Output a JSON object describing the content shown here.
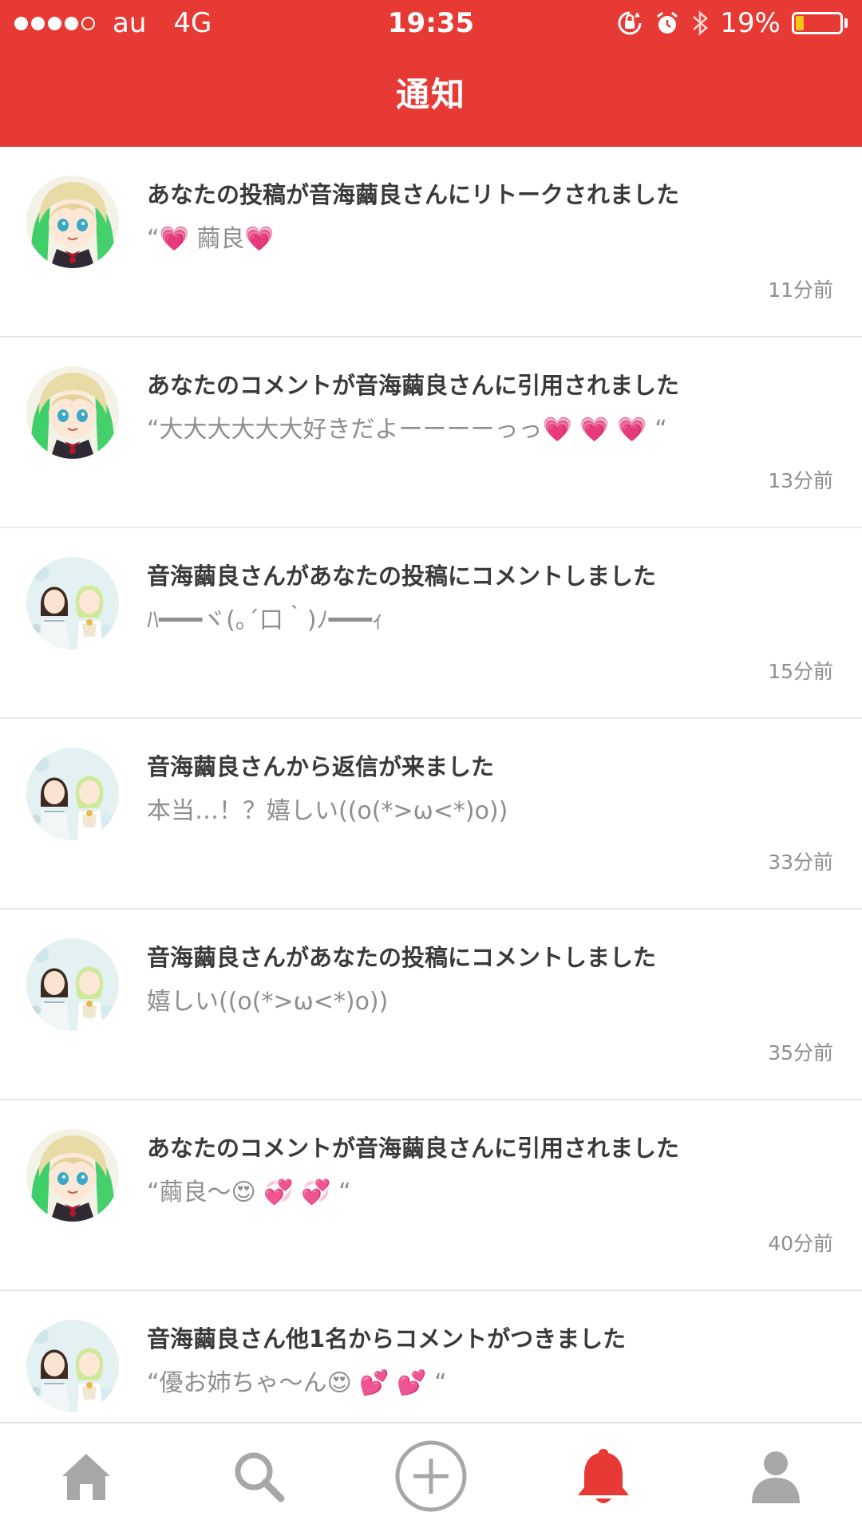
{
  "status_bar": {
    "carrier": "au",
    "network": "4G",
    "time": "19:35",
    "battery": "19%",
    "battery_level": 0.19,
    "signal_bars": 4
  },
  "header": {
    "title": "通知"
  },
  "notifications": [
    {
      "title": "あなたの投稿が音海繭良さんにリトークされました",
      "body": "“💗 繭良💗",
      "time": "11分前",
      "avatar": "green-hair"
    },
    {
      "title": "あなたのコメントが音海繭良さんに引用されました",
      "body": "“大大大大大大好きだよーーーーっっ💗 💗 💗 “",
      "time": "13分前",
      "avatar": "green-hair"
    },
    {
      "title": "音海繭良さんがあなたの投稿にコメントしました",
      "body": "ﾊ━━━ヾ(｡´口｀)ﾉ━━━ｨ",
      "time": "15分前",
      "avatar": "pair"
    },
    {
      "title": "音海繭良さんから返信が来ました",
      "body": "本当…！？嬉しい((o(*>ω<*)o))",
      "time": "33分前",
      "avatar": "pair"
    },
    {
      "title": "音海繭良さんがあなたの投稿にコメントしました",
      "body": "嬉しい((o(*>ω<*)o))",
      "time": "35分前",
      "avatar": "pair"
    },
    {
      "title": "あなたのコメントが音海繭良さんに引用されました",
      "body": "“繭良〜😍 💞 💞 “",
      "time": "40分前",
      "avatar": "green-hair"
    },
    {
      "title": "音海繭良さん他1名からコメントがつきました",
      "body": "“優お姉ちゃ〜ん😍 💕 💕 “",
      "time": "",
      "avatar": "pair"
    }
  ],
  "tabbar": {
    "tabs": [
      {
        "name": "home",
        "icon": "home-icon"
      },
      {
        "name": "search",
        "icon": "search-icon"
      },
      {
        "name": "post",
        "icon": "plus-circle-icon"
      },
      {
        "name": "notifications",
        "icon": "bell-icon",
        "active": true
      },
      {
        "name": "profile",
        "icon": "person-icon"
      }
    ],
    "colors": {
      "active": "#e83a35",
      "inactive": "#a7a7a7"
    }
  },
  "colors": {
    "accent": "#e83a35",
    "text": "#3a3a3a",
    "muted": "#8e8e8e"
  }
}
